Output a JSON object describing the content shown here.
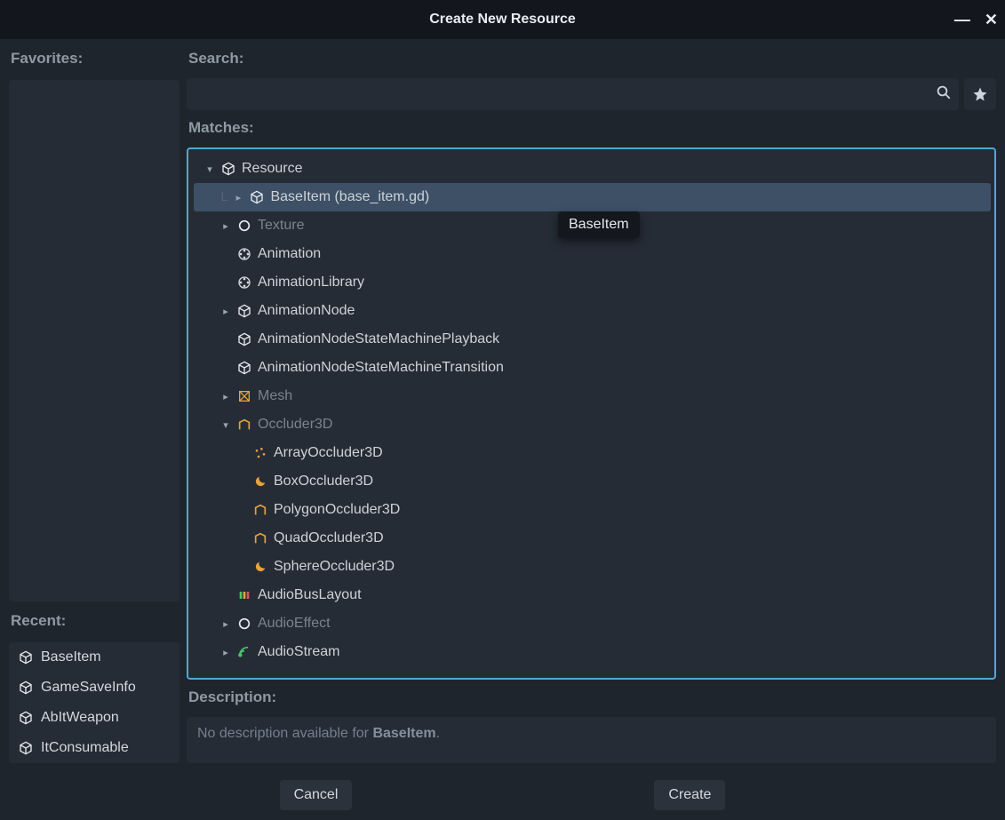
{
  "titlebar": {
    "title": "Create New Resource"
  },
  "left": {
    "favorites_label": "Favorites:",
    "recent_label": "Recent:",
    "recent": [
      {
        "label": "BaseItem",
        "icon": "cube"
      },
      {
        "label": "GameSaveInfo",
        "icon": "cube"
      },
      {
        "label": "AbItWeapon",
        "icon": "cube"
      },
      {
        "label": "ItConsumable",
        "icon": "cube"
      }
    ]
  },
  "search": {
    "label": "Search:",
    "value": "",
    "placeholder": ""
  },
  "matches": {
    "label": "Matches:",
    "tree": [
      {
        "depth": 0,
        "label": "Resource",
        "icon": "cube",
        "arrow": "down",
        "abstract": false
      },
      {
        "depth": 1,
        "label": "BaseItem (base_item.gd)",
        "icon": "cube",
        "arrow": "right",
        "selected": true,
        "guide": "L"
      },
      {
        "depth": 1,
        "label": "Texture",
        "icon": "circle",
        "arrow": "right",
        "abstract": true
      },
      {
        "depth": 1,
        "label": "Animation",
        "icon": "film"
      },
      {
        "depth": 1,
        "label": "AnimationLibrary",
        "icon": "film"
      },
      {
        "depth": 1,
        "label": "AnimationNode",
        "icon": "cube",
        "arrow": "right"
      },
      {
        "depth": 1,
        "label": "AnimationNodeStateMachinePlayback",
        "icon": "cube"
      },
      {
        "depth": 1,
        "label": "AnimationNodeStateMachineTransition",
        "icon": "cube"
      },
      {
        "depth": 1,
        "label": "Mesh",
        "icon": "mesh",
        "arrow": "right",
        "abstract": true
      },
      {
        "depth": 1,
        "label": "Occluder3D",
        "icon": "occ",
        "arrow": "down",
        "abstract": true
      },
      {
        "depth": 2,
        "label": "ArrayOccluder3D",
        "icon": "occ-dots"
      },
      {
        "depth": 2,
        "label": "BoxOccluder3D",
        "icon": "moon"
      },
      {
        "depth": 2,
        "label": "PolygonOccluder3D",
        "icon": "occ"
      },
      {
        "depth": 2,
        "label": "QuadOccluder3D",
        "icon": "occ"
      },
      {
        "depth": 2,
        "label": "SphereOccluder3D",
        "icon": "moon"
      },
      {
        "depth": 1,
        "label": "AudioBusLayout",
        "icon": "bus"
      },
      {
        "depth": 1,
        "label": "AudioEffect",
        "icon": "circle",
        "arrow": "right",
        "abstract": true
      },
      {
        "depth": 1,
        "label": "AudioStream",
        "icon": "stream",
        "arrow": "right"
      }
    ]
  },
  "tooltip": {
    "text": "BaseItem"
  },
  "description": {
    "label": "Description:",
    "prefix": "No description available for ",
    "name": "BaseItem",
    "suffix": "."
  },
  "buttons": {
    "cancel": "Cancel",
    "create": "Create"
  }
}
